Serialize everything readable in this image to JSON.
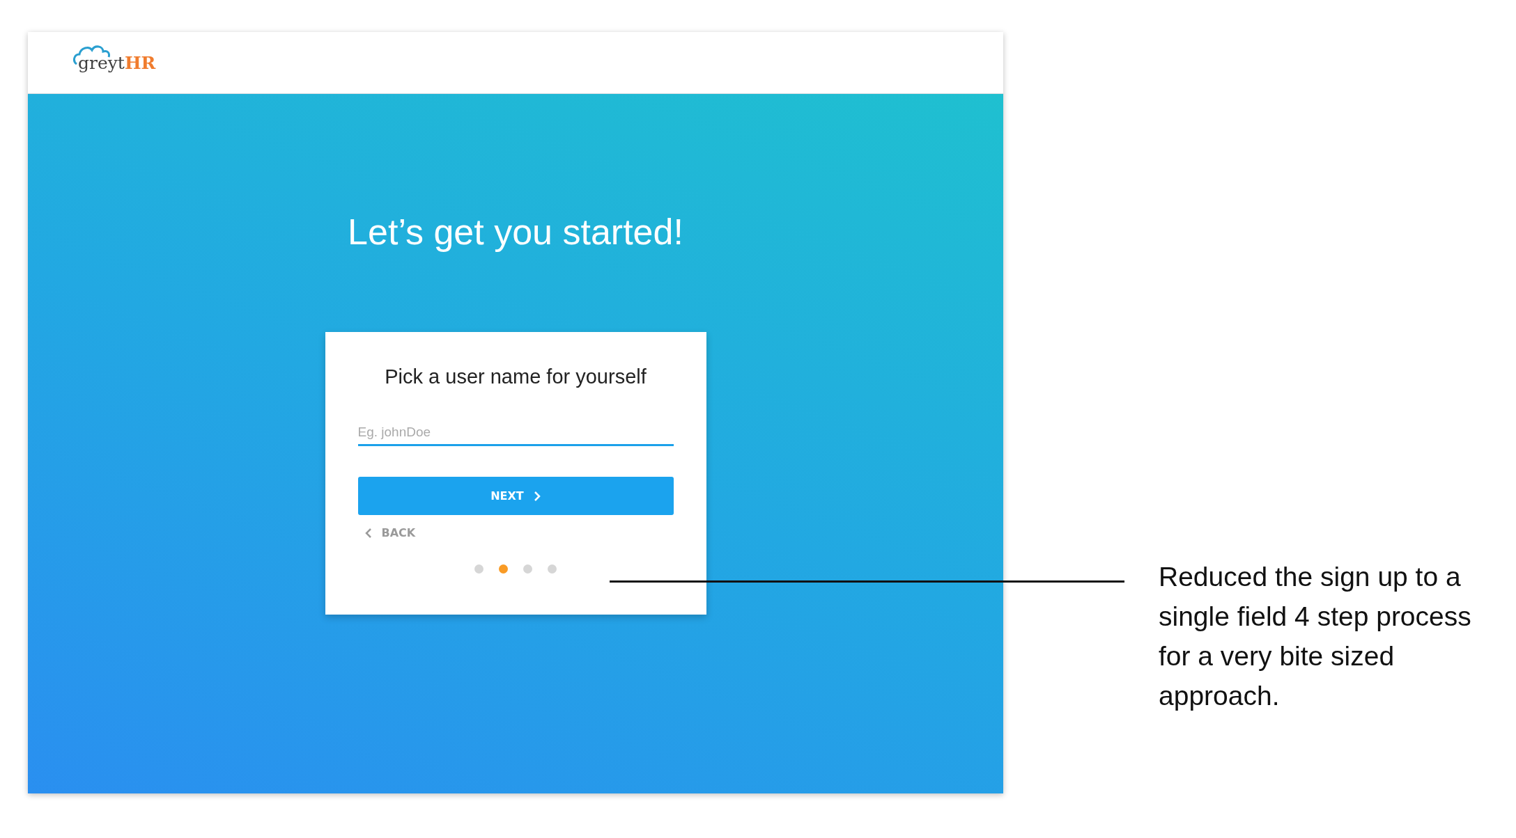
{
  "header": {
    "logo": {
      "text": "greyt",
      "accent": "HR"
    }
  },
  "heading": "Let’s get you started!",
  "card": {
    "title": "Pick a user name for yourself",
    "field": {
      "placeholder": "Eg. johnDoe"
    },
    "next_button": "NEXT",
    "back_link": "BACK",
    "steps": [
      {
        "selected": false
      },
      {
        "selected": true
      },
      {
        "selected": false
      },
      {
        "selected": false
      }
    ]
  },
  "annotation": "Reduced the sign up to a single field 4 step process for a very bite sized approach."
}
